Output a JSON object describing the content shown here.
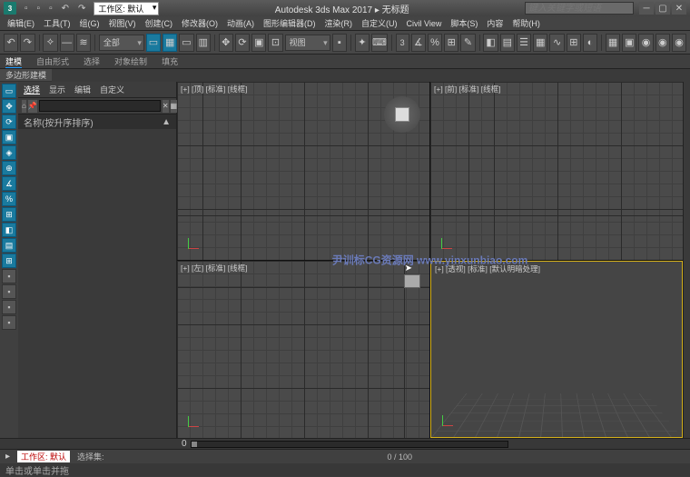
{
  "title": {
    "app": "Autodesk 3ds Max 2017",
    "doc": "无标题",
    "combined": "Autodesk 3ds Max 2017 ▸ 无标题"
  },
  "workspace_dd": "工作区: 默认",
  "search_placeholder": "键入关键字或短语",
  "menus": [
    "编辑(E)",
    "工具(T)",
    "组(G)",
    "视图(V)",
    "创建(C)",
    "修改器(O)",
    "动画(A)",
    "图形编辑器(D)",
    "渲染(R)",
    "自定义(U)",
    "Civil View",
    "脚本(S)",
    "内容",
    "帮助(H)"
  ],
  "ribbon_tabs": [
    "建模",
    "自由形式",
    "选择",
    "对象绘制",
    "填充"
  ],
  "ribbon_group": "多边形建模",
  "toolbar2_dd1": "全部",
  "toolbar2_dd2": "视图",
  "scene": {
    "tabs": [
      "选择",
      "显示",
      "编辑",
      "自定义"
    ],
    "active_tab": 0,
    "header": "名称(按升序排序)",
    "chevron": "▲"
  },
  "viewports": {
    "tl": "[+] [顶] [标准] [线框]",
    "tr": "[+] [前] [标准] [线框]",
    "bl": "[+] [左] [标准] [线框]",
    "br": "[+] [透视] [标准] [默认明暗处理]"
  },
  "watermark": "尹训标CG资源网 www.yinxunbiao.com",
  "timeline": {
    "frame_label": "0 / 100",
    "zero": "0"
  },
  "status": {
    "ws": "工作区: 默认",
    "sel": "选择集:",
    "prompt": "单击或单击并拖"
  },
  "icons": {
    "undo": "↶",
    "redo": "↷",
    "link": "⟡",
    "dash": "—",
    "select": "▭",
    "move": "✥",
    "rotate": "⟳",
    "scale": "▣",
    "percent": "%",
    "cog": "⚙",
    "snap": "⊕",
    "angle": "∡",
    "three": "3",
    "half": "½",
    "key": "✪",
    "render": "◉"
  }
}
